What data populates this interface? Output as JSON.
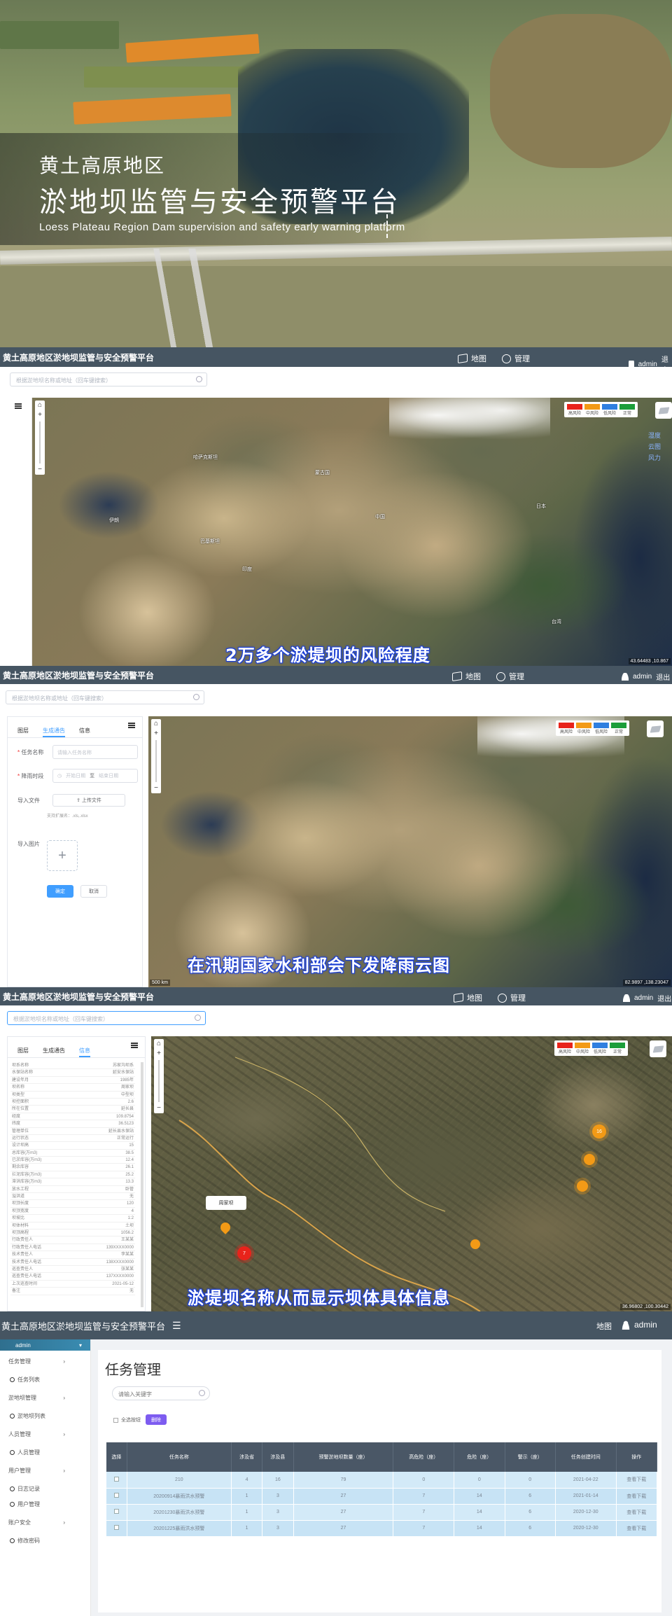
{
  "hero": {
    "title_line1": "黄土高原地区",
    "title_line2": "淤地坝监管与安全预警平台",
    "subtitle": "Loess Plateau Region Dam supervision and safety early warning platform"
  },
  "app": {
    "title": "黄土高原地区淤地坝监管与安全预警平台",
    "nav_map": "地图",
    "nav_manage": "管理",
    "user": "admin",
    "logout": "退出"
  },
  "search": {
    "placeholder": "根据淤地坝名称或地址（回车键搜索）"
  },
  "legend": [
    {
      "label": "高风险",
      "color": "#e8231b"
    },
    {
      "label": "中风险",
      "color": "#f39a16"
    },
    {
      "label": "低风险",
      "color": "#2f7fe0"
    },
    {
      "label": "正常",
      "color": "#1c9e3a"
    }
  ],
  "layers": {
    "items": [
      "湿度",
      "云图",
      "风力"
    ]
  },
  "screen1": {
    "caption": "2万多个淤堤坝的风险程度",
    "coord": "43.64483 ,10.867",
    "labels": {
      "mongolia": "蒙古国",
      "kazakhstan": "哈萨克斯坦",
      "china": "中国",
      "japan": "日本",
      "pakistan": "巴基斯坦",
      "india": "印度",
      "iran": "伊朗",
      "taiwan": "台湾"
    }
  },
  "screen2": {
    "caption": "在汛期国家水利部会下发降雨云图",
    "coord": "82.9897 ,138.23047",
    "scale": "500 km",
    "tabs": [
      "图层",
      "生成通告",
      "信息"
    ],
    "form": {
      "task_label": "任务名称",
      "task_placeholder": "请输入任务名称",
      "time_label": "降雨时段",
      "start_placeholder": "开始日期",
      "to": "至",
      "end_placeholder": "结束日期",
      "import_file_label": "导入文件",
      "upload_btn": "上传文件",
      "support_text": "支持扩展名：.xls,.xlsx",
      "import_image_label": "导入图片",
      "plus": "+",
      "confirm": "确定",
      "cancel": "取消"
    }
  },
  "screen3": {
    "caption": "淤堤坝名称从而显示坝体具体信息",
    "coord": "36.96802 ,100.30442",
    "popup": "周家坝",
    "cluster_red": "7",
    "cluster_or": "16",
    "info_rows": [
      [
        "坝系名称",
        "苏家沟坝系"
      ],
      [
        "水保站名称",
        "延安水保站"
      ],
      [
        "建设年月",
        "1985年"
      ],
      [
        "坝名称",
        "周家坝"
      ],
      [
        "坝类型",
        "中型坝"
      ],
      [
        "坝控面积",
        "2.6"
      ],
      [
        "所在位置",
        "延长县"
      ],
      [
        "经度",
        "109.8754"
      ],
      [
        "纬度",
        "36.5123"
      ],
      [
        "管理单位",
        "延长县水保站"
      ],
      [
        "运行状态",
        "正常运行"
      ],
      [
        "设计坝高",
        "15"
      ],
      [
        "总库容(万m3)",
        "38.5"
      ],
      [
        "已淤库容(万m3)",
        "12.4"
      ],
      [
        "剩余库容",
        "26.1"
      ],
      [
        "拦泥库容(万m3)",
        "25.2"
      ],
      [
        "滞洪库容(万m3)",
        "13.3"
      ],
      [
        "放水工程",
        "卧管"
      ],
      [
        "溢洪道",
        "无"
      ],
      [
        "坝顶长度",
        "120"
      ],
      [
        "坝顶宽度",
        "4"
      ],
      [
        "坝坡比",
        "1:2"
      ],
      [
        "坝体材料",
        "土坝"
      ],
      [
        "坝顶高程",
        "1056.2"
      ],
      [
        "行政责任人",
        "王某某"
      ],
      [
        "行政责任人电话",
        "139XXXX0000"
      ],
      [
        "技术责任人",
        "李某某"
      ],
      [
        "技术责任人电话",
        "138XXXX0000"
      ],
      [
        "巡查责任人",
        "张某某"
      ],
      [
        "巡查责任人电话",
        "137XXXX0000"
      ],
      [
        "上次巡查时间",
        "2021-05-12"
      ],
      [
        "备注",
        "无"
      ]
    ]
  },
  "admin": {
    "header_title": "黄土高原地区淤地坝监管与安全预警平台",
    "nav_map": "地图",
    "user": "admin",
    "page_title": "任务管理",
    "search_placeholder": "请输入关键字",
    "select_all": "全选按钮",
    "delete_btn": "删除",
    "menu": [
      {
        "group": "任务管理",
        "subs": [
          "任务列表"
        ]
      },
      {
        "group": "淤地坝管理",
        "subs": [
          "淤地坝列表"
        ]
      },
      {
        "group": "人员管理",
        "subs": [
          "人员管理"
        ]
      },
      {
        "group": "用户管理",
        "subs": [
          "日志记录",
          "用户管理"
        ]
      },
      {
        "group": "账户安全",
        "subs": [
          "修改密码"
        ]
      }
    ],
    "columns": [
      "选择",
      "任务名称",
      "涉及省",
      "涉及县",
      "预警淤地坝数量（座）",
      "高危险（座）",
      "危险（座）",
      "警示（座）",
      "任务创建时间",
      "操作"
    ],
    "rows": [
      [
        "",
        "210",
        "4",
        "16",
        "79",
        "0",
        "0",
        "0",
        "2021-04-22",
        "查看|下载"
      ],
      [
        "",
        "20200914暴雨洪水预警",
        "1",
        "3",
        "27",
        "7",
        "14",
        "6",
        "2021-01-14",
        "查看|下载"
      ],
      [
        "",
        "20201230暴雨洪水预警",
        "1",
        "3",
        "27",
        "7",
        "14",
        "6",
        "2020-12-30",
        "查看|下载"
      ],
      [
        "",
        "20201225暴雨洪水预警",
        "1",
        "3",
        "27",
        "7",
        "14",
        "6",
        "2020-12-30",
        "查看|下载"
      ]
    ]
  }
}
